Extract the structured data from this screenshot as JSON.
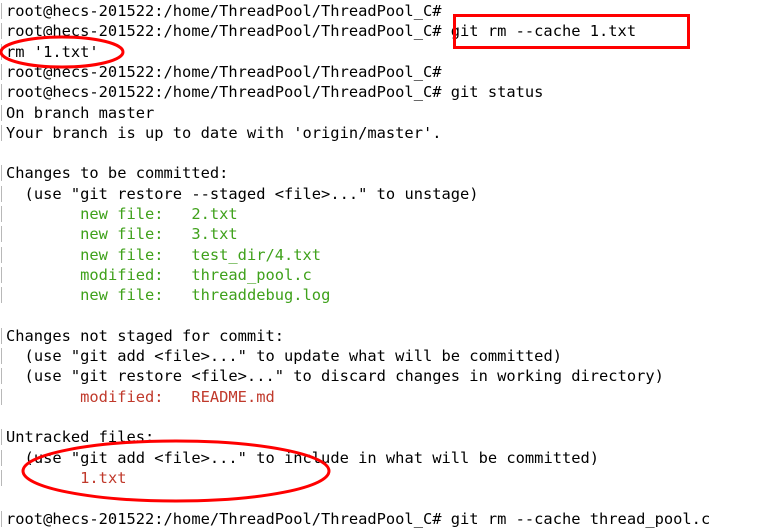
{
  "terminal": {
    "prompt": "root@hecs-201522:/home/ThreadPool/ThreadPool_C#",
    "lines": [
      {
        "indent": "",
        "label": "",
        "text": "root@hecs-201522:/home/ThreadPool/ThreadPool_C#",
        "color": "default"
      },
      {
        "indent": "",
        "label": "",
        "text": "root@hecs-201522:/home/ThreadPool/ThreadPool_C# git rm --cache 1.txt",
        "color": "default"
      },
      {
        "indent": "",
        "label": "",
        "text": "rm '1.txt'",
        "color": "default"
      },
      {
        "indent": "",
        "label": "",
        "text": "root@hecs-201522:/home/ThreadPool/ThreadPool_C#",
        "color": "default"
      },
      {
        "indent": "",
        "label": "",
        "text": "root@hecs-201522:/home/ThreadPool/ThreadPool_C# git status",
        "color": "default"
      },
      {
        "indent": "",
        "label": "",
        "text": "On branch master",
        "color": "default"
      },
      {
        "indent": "",
        "label": "",
        "text": "Your branch is up to date with 'origin/master'.",
        "color": "default"
      },
      {
        "indent": "",
        "label": "",
        "text": "",
        "color": "default"
      },
      {
        "indent": "",
        "label": "",
        "text": "Changes to be committed:",
        "color": "default"
      },
      {
        "indent": "  ",
        "label": "",
        "text": "(use \"git restore --staged <file>...\" to unstage)",
        "color": "default"
      },
      {
        "indent": "        ",
        "label": "new file:   ",
        "text": "2.txt",
        "color": "green"
      },
      {
        "indent": "        ",
        "label": "new file:   ",
        "text": "3.txt",
        "color": "green"
      },
      {
        "indent": "        ",
        "label": "new file:   ",
        "text": "test_dir/4.txt",
        "color": "green"
      },
      {
        "indent": "        ",
        "label": "modified:   ",
        "text": "thread_pool.c",
        "color": "green"
      },
      {
        "indent": "        ",
        "label": "new file:   ",
        "text": "threaddebug.log",
        "color": "green"
      },
      {
        "indent": "",
        "label": "",
        "text": "",
        "color": "default"
      },
      {
        "indent": "",
        "label": "",
        "text": "Changes not staged for commit:",
        "color": "default"
      },
      {
        "indent": "  ",
        "label": "",
        "text": "(use \"git add <file>...\" to update what will be committed)",
        "color": "default"
      },
      {
        "indent": "  ",
        "label": "",
        "text": "(use \"git restore <file>...\" to discard changes in working directory)",
        "color": "default"
      },
      {
        "indent": "        ",
        "label": "modified:   ",
        "text": "README.md",
        "color": "red"
      },
      {
        "indent": "",
        "label": "",
        "text": "",
        "color": "default"
      },
      {
        "indent": "",
        "label": "",
        "text": "Untracked files:",
        "color": "default"
      },
      {
        "indent": "  ",
        "label": "",
        "text": "(use \"git add <file>...\" to include in what will be committed)",
        "color": "default"
      },
      {
        "indent": "        ",
        "label": "",
        "text": "1.txt",
        "color": "red"
      },
      {
        "indent": "",
        "label": "",
        "text": "",
        "color": "default"
      },
      {
        "indent": "",
        "label": "",
        "text": "root@hecs-201522:/home/ThreadPool/ThreadPool_C# git rm --cache thread_pool.c",
        "color": "default"
      }
    ]
  },
  "colors": {
    "default": "#000000",
    "green": "#3fa11b",
    "red": "#c0392b",
    "annotation": "#ff0000"
  },
  "annotations": [
    {
      "shape": "rectangle",
      "color": "#ff0000",
      "marks": "git rm --cache 1.txt"
    },
    {
      "shape": "ellipse",
      "color": "#ff0000",
      "marks": "rm '1.txt'"
    },
    {
      "shape": "ellipse",
      "color": "#ff0000",
      "marks": "1.txt"
    }
  ]
}
